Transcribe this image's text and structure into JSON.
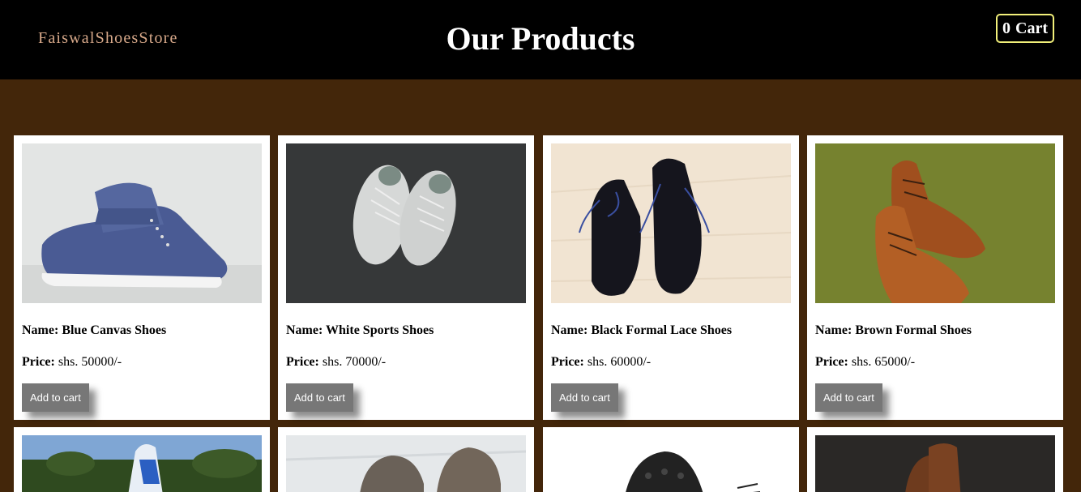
{
  "navbar": {
    "brand": "FaiswalShoesStore",
    "title": "Our Products",
    "cart_count": "0",
    "cart_label": "Cart",
    "border_color": "#f2f07a"
  },
  "products": [
    {
      "name_label": "Name:",
      "name": "Blue Canvas Shoes",
      "price_label": "Price:",
      "price": "shs. 50000/-",
      "button": "Add to cart",
      "image_icon": "blue-canvas-shoes-image"
    },
    {
      "name_label": "Name:",
      "name": "White Sports Shoes",
      "price_label": "Price:",
      "price": "shs. 70000/-",
      "button": "Add to cart",
      "image_icon": "white-sports-shoes-image"
    },
    {
      "name_label": "Name:",
      "name": "Black Formal Lace Shoes",
      "price_label": "Price:",
      "price": "shs. 60000/-",
      "button": "Add to cart",
      "image_icon": "black-formal-shoes-image"
    },
    {
      "name_label": "Name:",
      "name": "Brown Formal Shoes",
      "price_label": "Price:",
      "price": "shs. 65000/-",
      "button": "Add to cart",
      "image_icon": "brown-formal-shoes-image"
    }
  ],
  "colors": {
    "page_bg": "#43260a",
    "navbar_bg": "#000000",
    "brand_text": "#d8a98a",
    "button_bg": "#777777"
  }
}
